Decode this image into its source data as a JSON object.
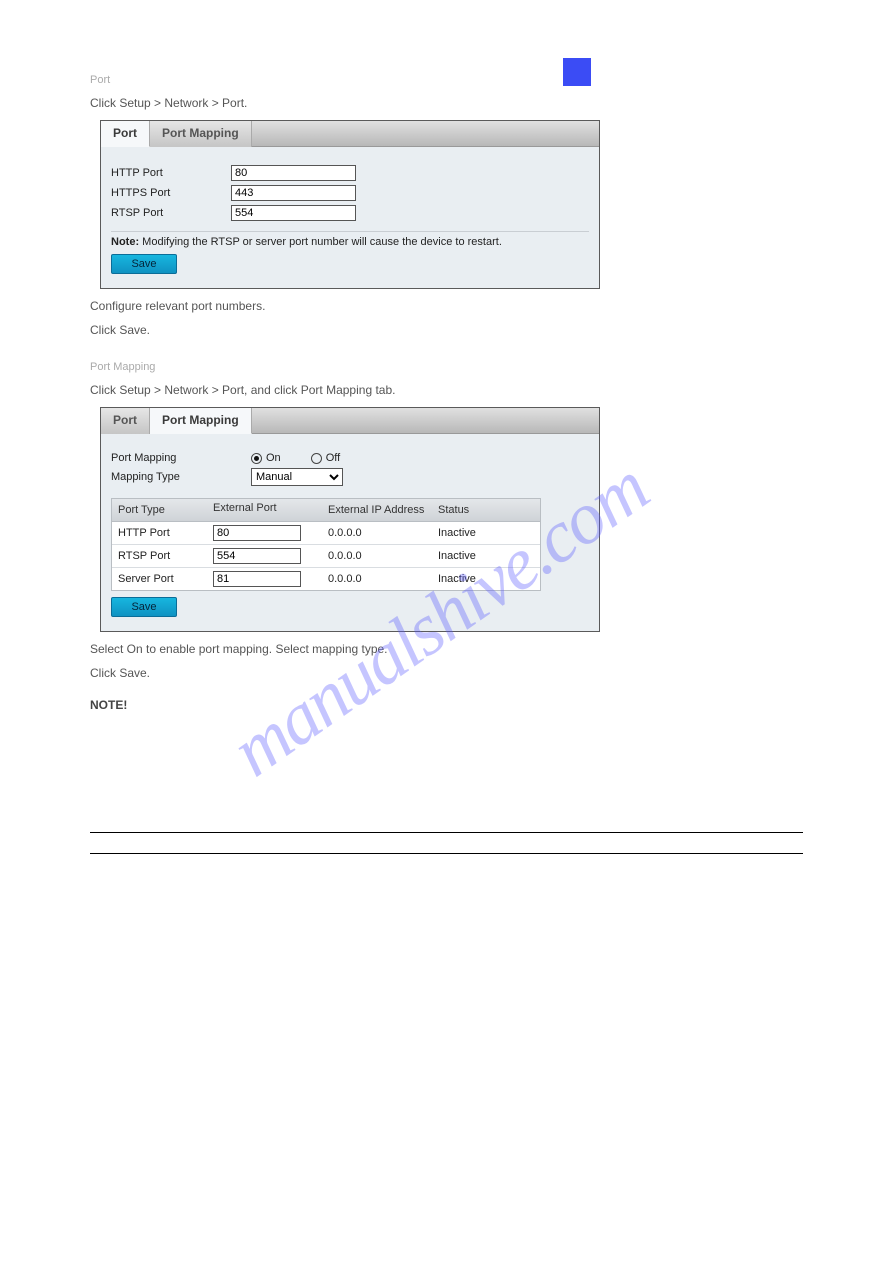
{
  "watermark": "manualshive.com",
  "intro": {
    "heading": "Port",
    "step1": "Click Setup > Network > Port.",
    "step2": "Configure relevant port numbers.",
    "step3": "Click Save."
  },
  "port_panel": {
    "tabs": {
      "port": "Port",
      "mapping": "Port Mapping"
    },
    "rows": {
      "http": {
        "label": "HTTP Port",
        "value": "80"
      },
      "https": {
        "label": "HTTPS Port",
        "value": "443"
      },
      "rtsp": {
        "label": "RTSP Port",
        "value": "554"
      }
    },
    "note_label": "Note:",
    "note_text": "Modifying the RTSP or server port number will cause the device to restart.",
    "save": "Save"
  },
  "mapping_intro": {
    "heading": "Port Mapping",
    "step1": "Click Setup > Network > Port, and click Port Mapping tab.",
    "step2": "Select On to enable port mapping. Select mapping type.",
    "step3": "Click Save."
  },
  "mapping_panel": {
    "tabs": {
      "port": "Port",
      "mapping": "Port Mapping"
    },
    "form": {
      "pm_label": "Port Mapping",
      "on": "On",
      "off": "Off",
      "mt_label": "Mapping Type",
      "mt_value": "Manual"
    },
    "table": {
      "head": {
        "type": "Port Type",
        "ext": "External Port",
        "ip": "External IP Address",
        "stat": "Status"
      },
      "rows": [
        {
          "type": "HTTP Port",
          "ext": "80",
          "ip": "0.0.0.0",
          "stat": "Inactive"
        },
        {
          "type": "RTSP Port",
          "ext": "554",
          "ip": "0.0.0.0",
          "stat": "Inactive"
        },
        {
          "type": "Server Port",
          "ext": "81",
          "ip": "0.0.0.0",
          "stat": "Inactive"
        }
      ]
    },
    "save": "Save"
  },
  "post_note": {
    "title": "NOTE!",
    "text": ""
  }
}
